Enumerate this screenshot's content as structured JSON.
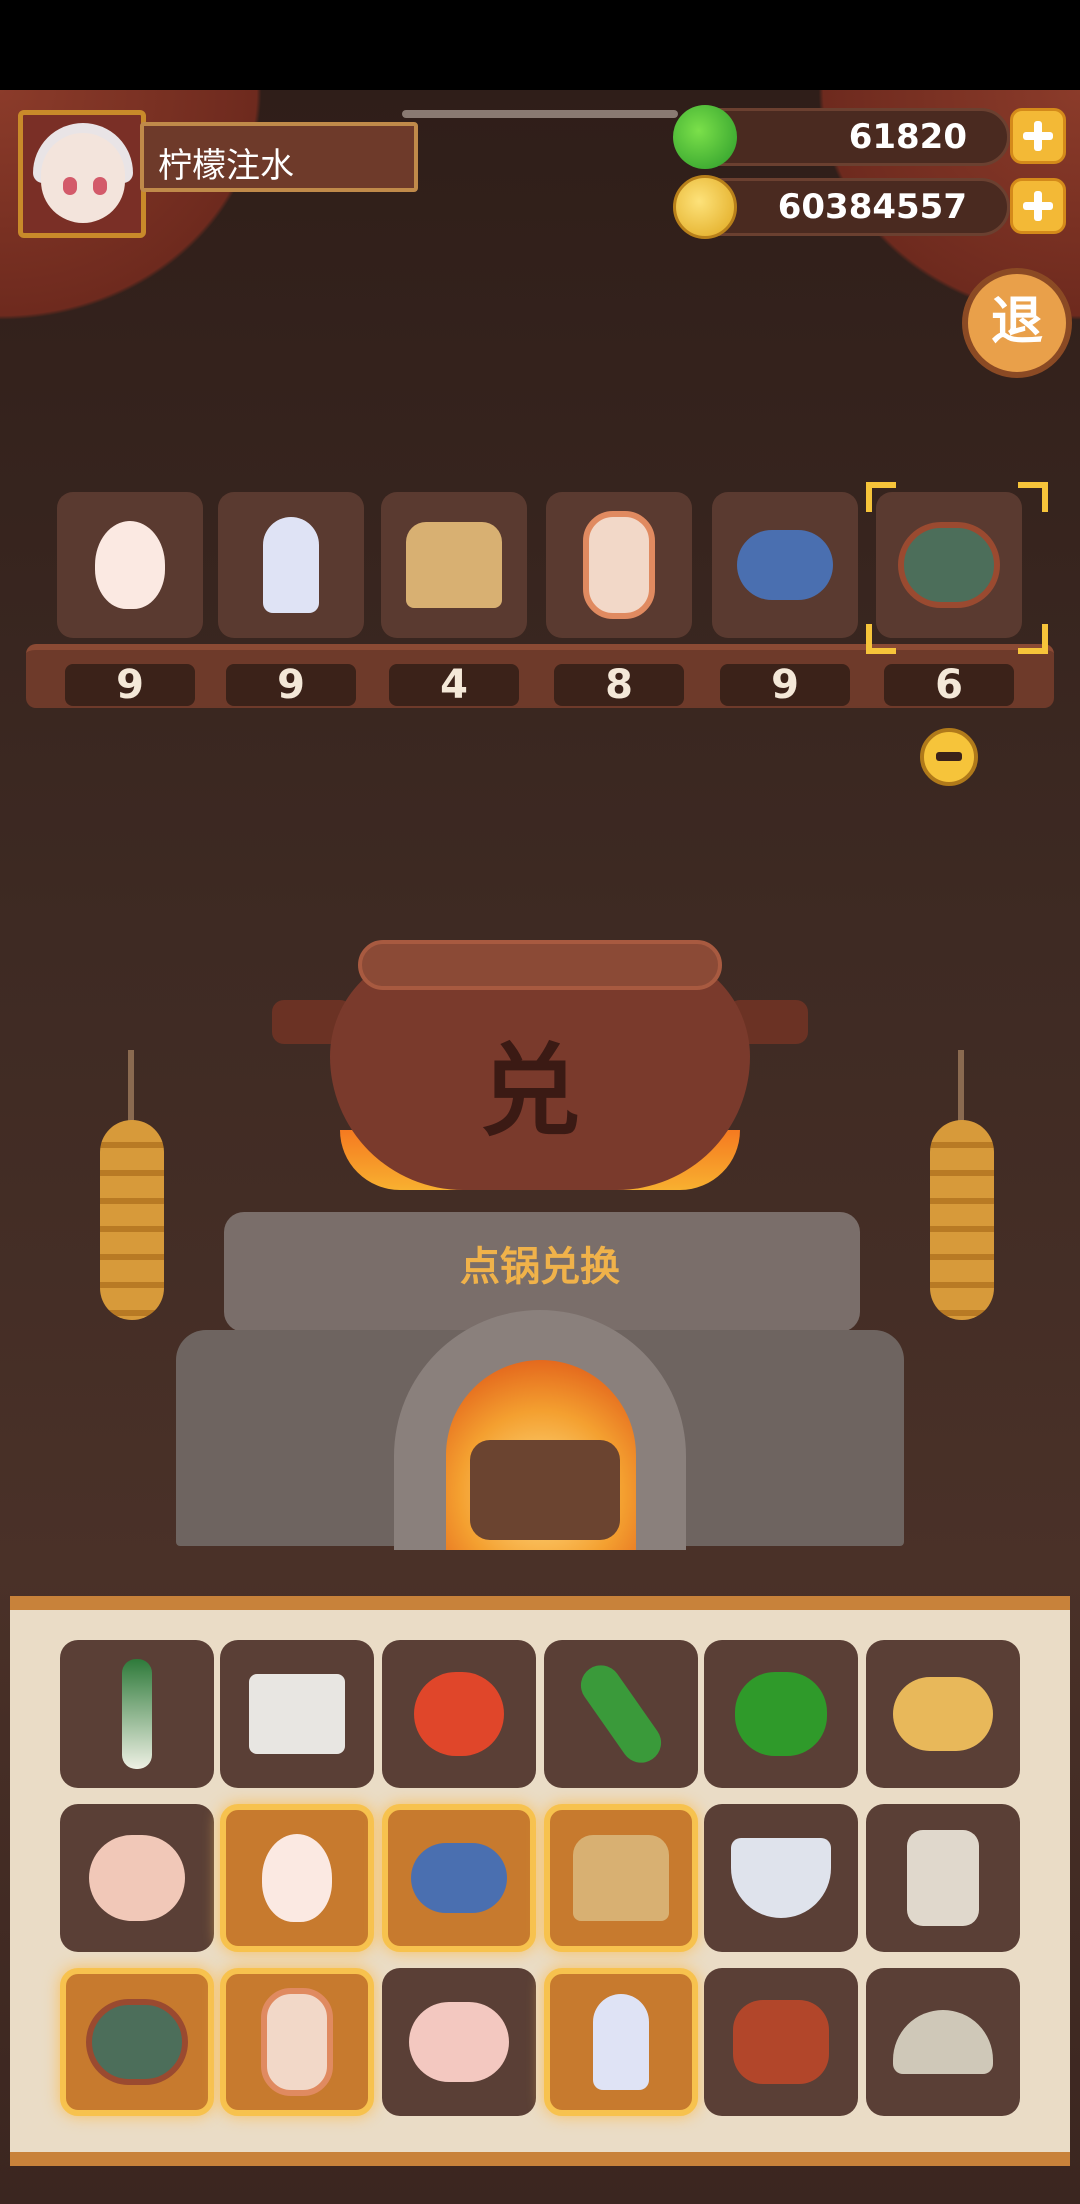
{
  "player": {
    "name": "柠檬注水"
  },
  "currency": {
    "jade": {
      "value": "61820",
      "icon": "jade-icon"
    },
    "gold": {
      "value": "60384557",
      "icon": "gold-coin-icon"
    }
  },
  "exit_button": {
    "label": "退"
  },
  "selected_ingredients": [
    {
      "icon": "egg-icon",
      "count": "9"
    },
    {
      "icon": "squid-icon",
      "count": "9"
    },
    {
      "icon": "flour-sack-icon",
      "count": "4"
    },
    {
      "icon": "shrimp-icon",
      "count": "8"
    },
    {
      "icon": "fish-icon",
      "count": "9"
    },
    {
      "icon": "crab-icon",
      "count": "6"
    }
  ],
  "pot": {
    "glyph": "兑",
    "action_label": "点锅兑换"
  },
  "inventory": [
    {
      "icon": "leek-icon",
      "selected": false
    },
    {
      "icon": "tofu-icon",
      "selected": false
    },
    {
      "icon": "tomato-icon",
      "selected": false
    },
    {
      "icon": "cucumber-icon",
      "selected": false
    },
    {
      "icon": "green-pepper-icon",
      "selected": false
    },
    {
      "icon": "potato-icon",
      "selected": false
    },
    {
      "icon": "chicken-icon",
      "selected": false
    },
    {
      "icon": "egg-icon",
      "selected": true
    },
    {
      "icon": "fish-icon",
      "selected": true
    },
    {
      "icon": "flour-sack-icon",
      "selected": true
    },
    {
      "icon": "rice-bowl-icon",
      "selected": false
    },
    {
      "icon": "jar-icon",
      "selected": false
    },
    {
      "icon": "crab-icon",
      "selected": true
    },
    {
      "icon": "shrimp-icon",
      "selected": true
    },
    {
      "icon": "duck-icon",
      "selected": false
    },
    {
      "icon": "squid-icon",
      "selected": true
    },
    {
      "icon": "meat-icon",
      "selected": false
    },
    {
      "icon": "clam-icon",
      "selected": false
    }
  ],
  "colors": {
    "accent": "#f6c43a",
    "selected_slot": "#c77a2e",
    "slot": "#5a3f36"
  }
}
